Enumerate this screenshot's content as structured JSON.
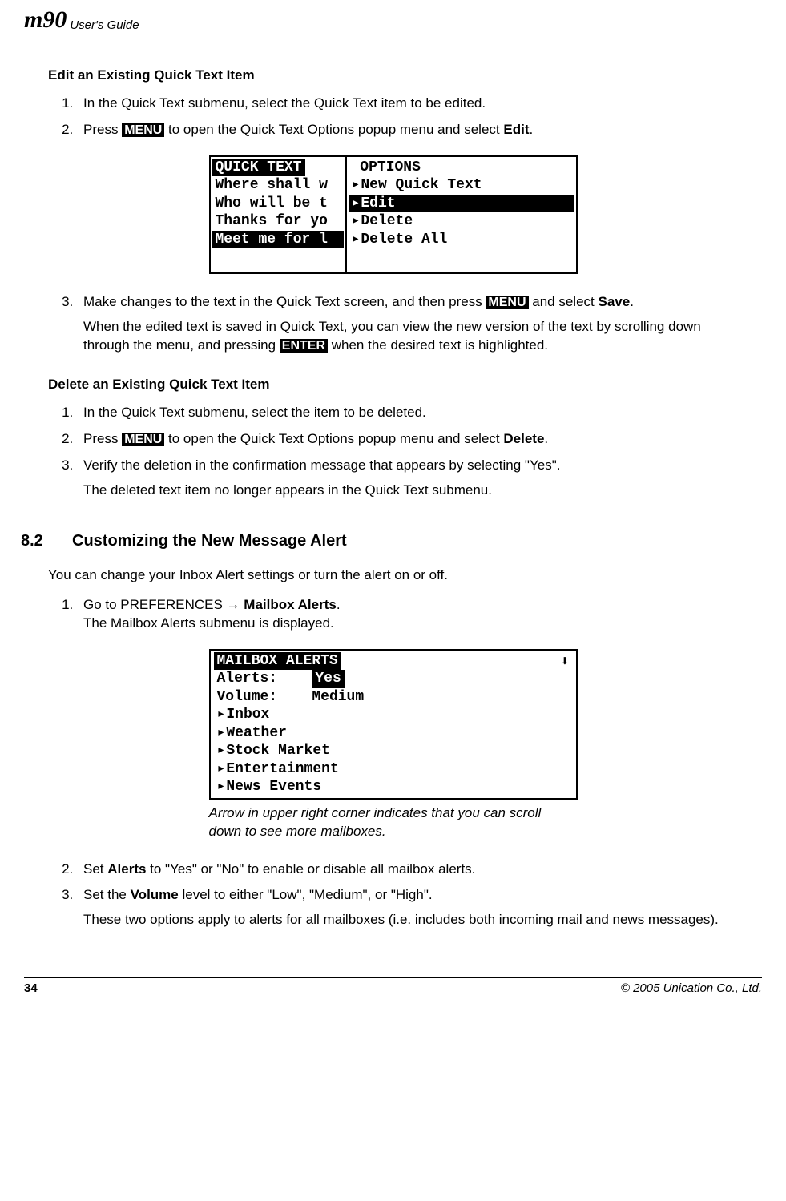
{
  "header": {
    "logo": "m90",
    "guide": "User's Guide"
  },
  "edit_section": {
    "title": "Edit an Existing Quick Text Item",
    "step1_a": "In the Quick Text submenu, select the Quick Text item to be edited.",
    "step2_a": "Press ",
    "step2_key": "MENU",
    "step2_b": " to open the Quick Text Options popup menu and select ",
    "step2_bold": "Edit",
    "step2_c": ".",
    "step3_a": "Make changes to the text in the Quick Text screen, and then press ",
    "step3_key": "MENU",
    "step3_b": " and select ",
    "step3_bold": "Save",
    "step3_c": ".",
    "step3_p_a": "When the edited text is saved in Quick Text, you can view the new version of the text by scrolling down through the menu, and pressing ",
    "step3_p_key": "ENTER",
    "step3_p_b": " when the desired text is highlighted."
  },
  "quick_text_screen": {
    "left_title": " QUICK TEXT ",
    "l1": "Where shall w",
    "l2": "Who will be t",
    "l3": "Thanks for yo",
    "l4": "Meet me for l",
    "right_title": " OPTIONS",
    "r1": "New Quick Text",
    "r2": "Edit",
    "r3": "Delete",
    "r4": "Delete All"
  },
  "delete_section": {
    "title": "Delete an Existing Quick Text Item",
    "step1": "In the Quick Text submenu, select the item to be deleted.",
    "step2_a": "Press ",
    "step2_key": "MENU",
    "step2_b": " to open the Quick Text Options popup menu and select ",
    "step2_bold": "Delete",
    "step2_c": ".",
    "step3": "Verify the deletion in the confirmation message that appears by selecting \"Yes\".",
    "step3_p": "The deleted text item no longer appears in the Quick Text submenu."
  },
  "section82": {
    "num": "8.2",
    "title": "Customizing the New Message Alert",
    "intro": "You can change your Inbox Alert settings or turn the alert on or off.",
    "step1_a": "Go to PREFERENCES → ",
    "step1_bold": "Mailbox Alerts",
    "step1_b": ".",
    "step1_line2": "The Mailbox Alerts submenu is displayed.",
    "caption": "Arrow in upper right corner indicates that you can scroll down to see more mailboxes.",
    "step2_a": "Set ",
    "step2_bold": "Alerts",
    "step2_b": " to \"Yes\" or \"No\" to enable or disable all mailbox alerts.",
    "step3_a": "Set the ",
    "step3_bold": "Volume",
    "step3_b": " level to either \"Low\", \"Medium\", or \"High\".",
    "step3_p": "These two options apply to alerts for all mailboxes (i.e. includes both incoming mail and news messages)."
  },
  "mailbox_screen": {
    "title": " MAILBOX ALERTS ",
    "alerts_label": "Alerts:",
    "alerts_value": "Yes",
    "volume_label": "Volume:",
    "volume_value": "Medium",
    "i1": "Inbox",
    "i2": "Weather",
    "i3": "Stock Market",
    "i4": "Entertainment",
    "i5": "News Events"
  },
  "footer": {
    "page": "34",
    "copyright": "© 2005 Unication Co., Ltd."
  }
}
